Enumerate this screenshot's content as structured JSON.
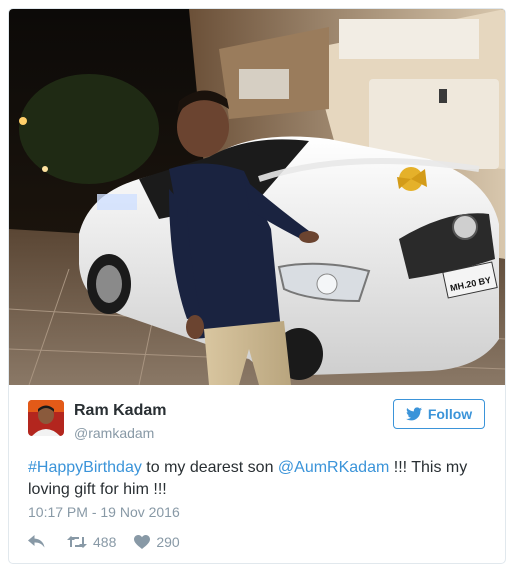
{
  "tweet": {
    "author": {
      "name": "Ram Kadam",
      "handle": "@ramkadam"
    },
    "follow_label": "Follow",
    "text": {
      "hashtag": "#HappyBirthday",
      "part1": " to my dearest son ",
      "mention": "@AumRKadam",
      "part2": " !!! This my loving gift for him !!!"
    },
    "timestamp": "10:17 PM - 19 Nov 2016",
    "retweet_count": "488",
    "like_count": "290",
    "photo": {
      "plate_text": "MH.20 BY"
    }
  },
  "colors": {
    "accent": "#3b94d9",
    "muted": "#8899a6",
    "text": "#292f33",
    "border": "#e1e8ed"
  },
  "icons": [
    "twitter-bird-icon",
    "reply-icon",
    "retweet-icon",
    "heart-icon"
  ]
}
